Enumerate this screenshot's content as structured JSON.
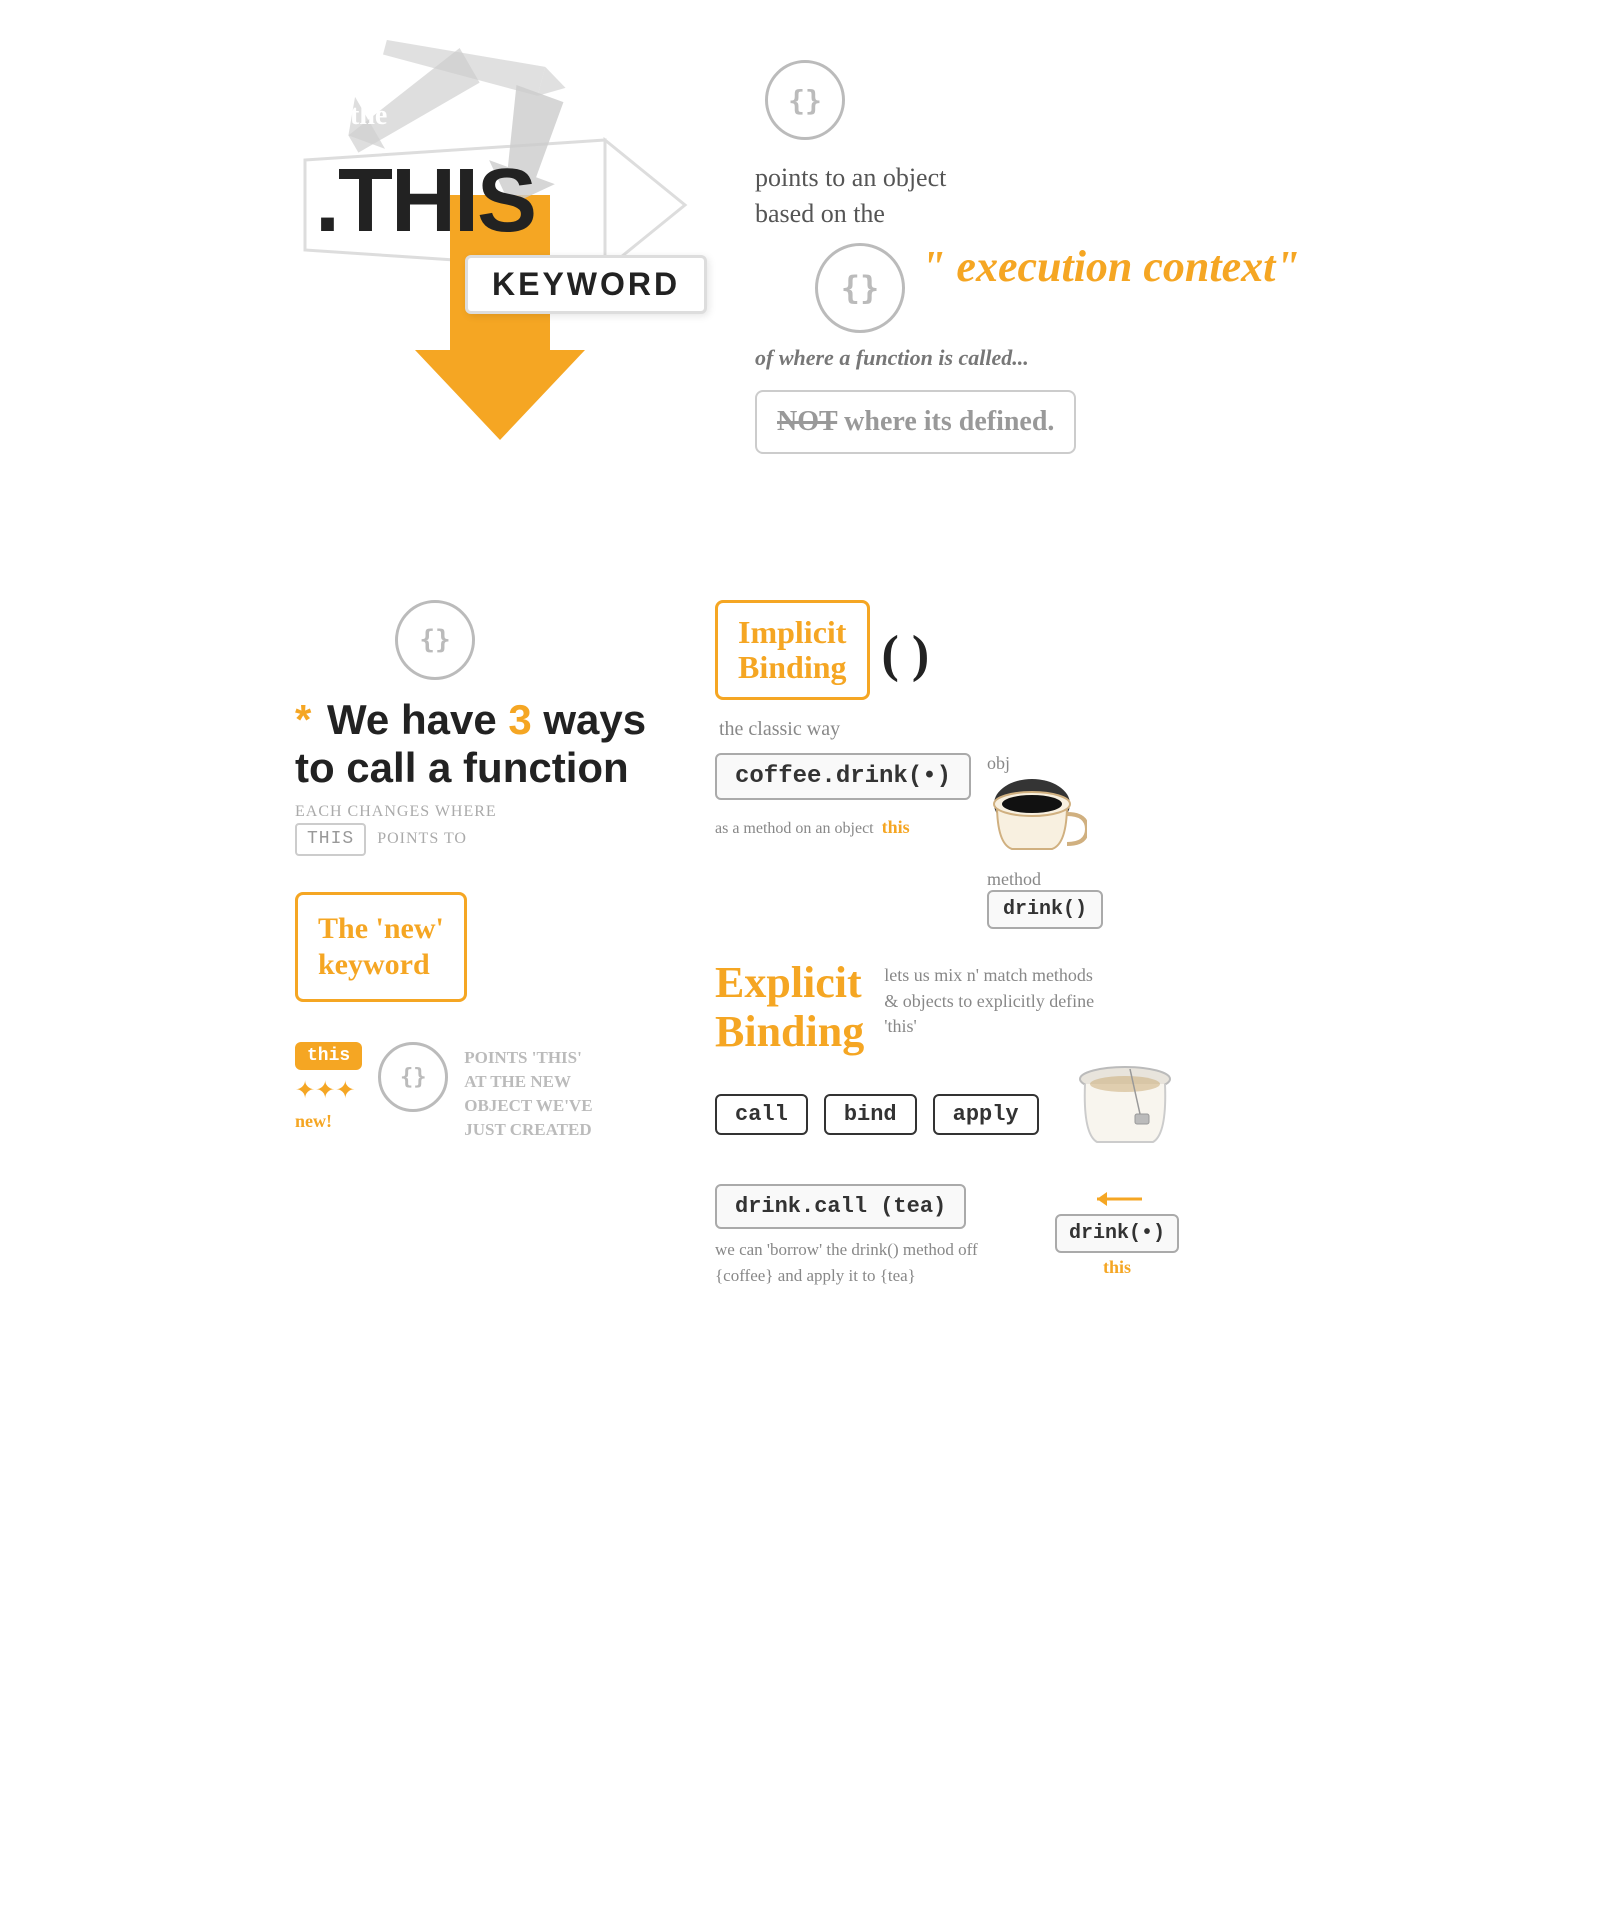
{
  "page": {
    "bg": "#ffffff"
  },
  "top": {
    "the_label": "the",
    "this_text": ".THIS",
    "keyword_text": "KEYWORD",
    "curly_top": "{}",
    "curly_mid": "{}",
    "points_to_line1": "points to an object",
    "points_to_line2": "based on the",
    "execution_context": "\" execution context\"",
    "where_function": "of where a function is called...",
    "not_label": "NOT",
    "not_rest": " where its defined."
  },
  "bottom": {
    "curly_bottom": "{}",
    "asterisk": "*",
    "we_have": "We have ",
    "three": "3",
    "ways_text": " ways to call a function",
    "each_changes": "EACH CHANGES WHERE",
    "this_badge": "this",
    "points_to": "POINTS TO",
    "new_keyword_line1": "The 'new'",
    "new_keyword_line2": "keyword",
    "curly_small": "{}",
    "points_this_1": "POINTS 'THIS'",
    "points_this_2": "AT THE NEW",
    "points_this_3": "OBJECT WE'VE",
    "points_this_4": "JUST CREATED",
    "new_label": "new!",
    "implicit_line1": "Implicit",
    "implicit_line2": "Binding",
    "paren": "(  )",
    "classic_way": "the classic way",
    "coffee_drink": "coffee.drink(•)",
    "obj_label": "obj",
    "method_label": "method",
    "drink_method": "drink()",
    "as_a_method": "as a method on an object",
    "this_label": "this",
    "explicit_line1": "Explicit",
    "explicit_line2": "Binding",
    "lets_us_mix": "lets us mix n' match methods & objects to explicitly define 'this'",
    "call_label": "call",
    "bind_label": "bind",
    "apply_label": "apply",
    "drink_call": "drink.call (tea)",
    "we_can_borrow": "we can 'borrow' the drink() method off {coffee} and apply it to {tea}",
    "drink_dot": "drink(•)",
    "this_bottom": "this"
  }
}
